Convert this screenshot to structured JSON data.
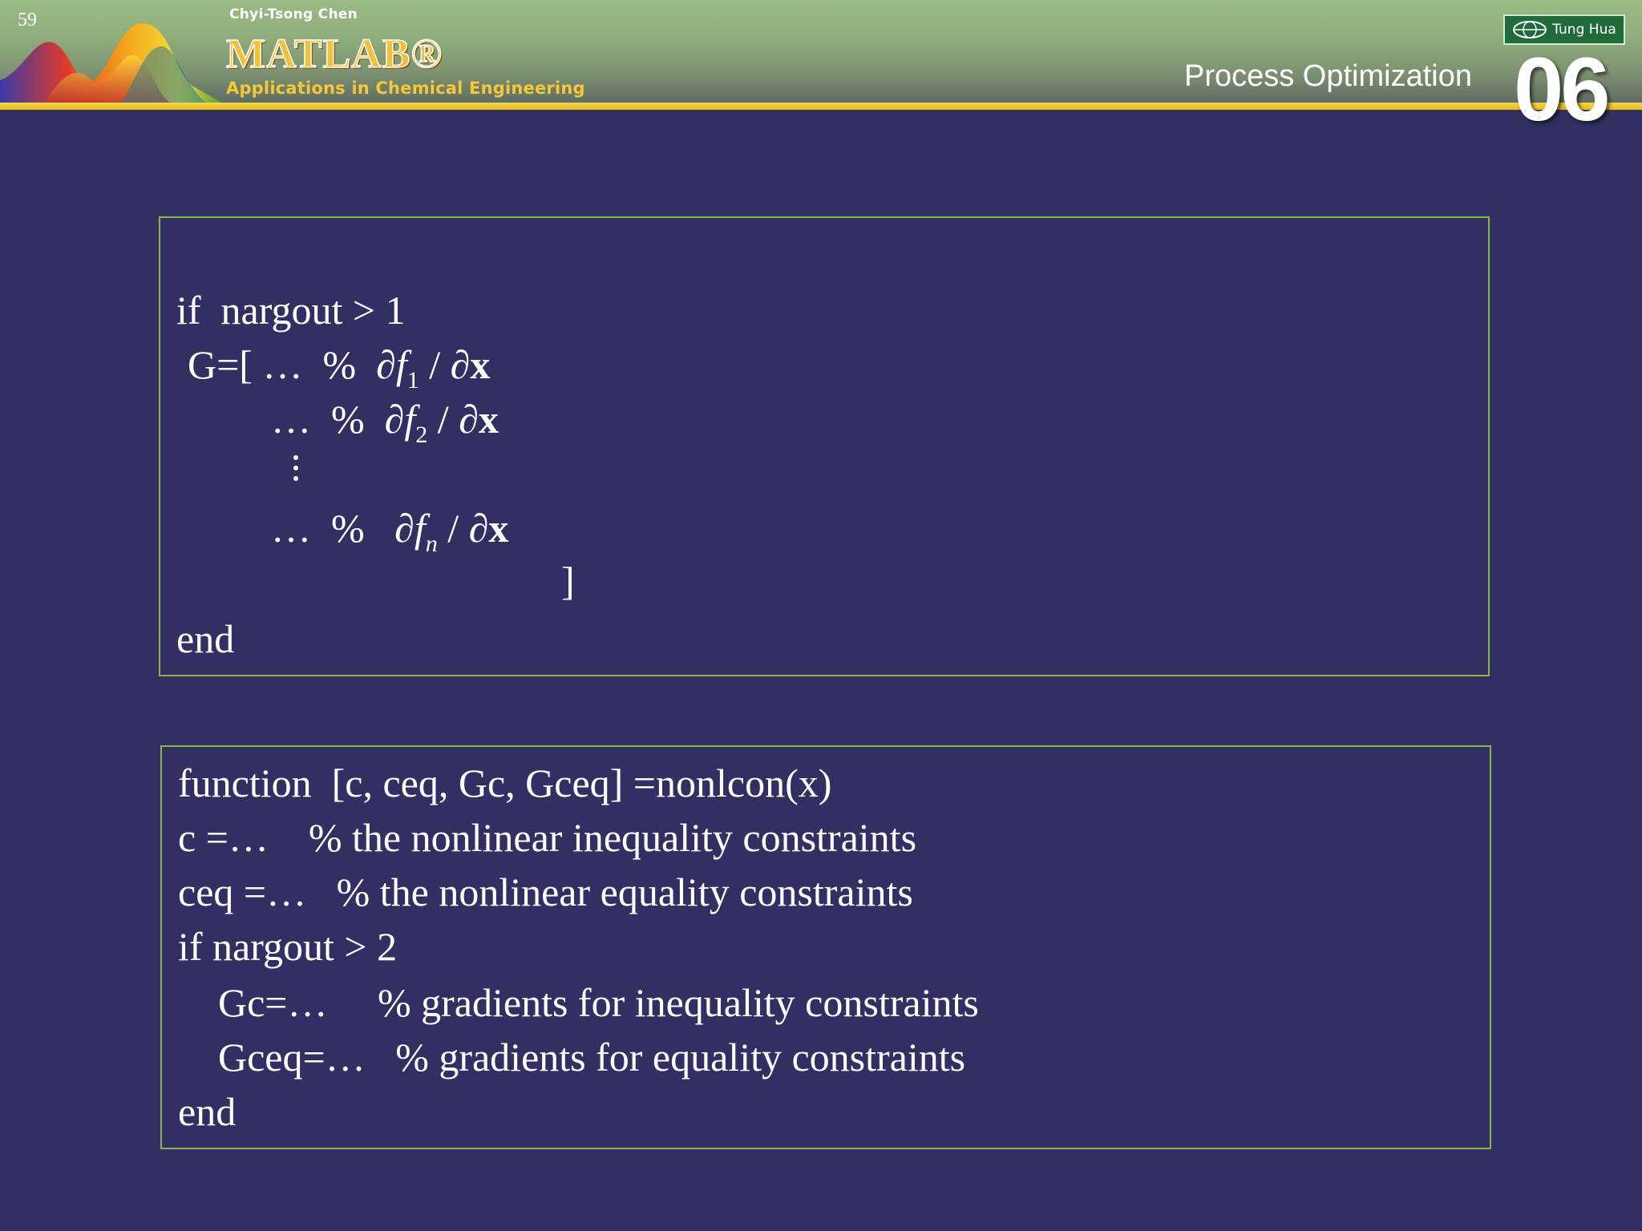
{
  "header": {
    "page_number": "59",
    "author": "Chyi-Tsong Chen",
    "book_title": "MATLAB®",
    "book_subtitle": "Applications in Chemical Engineering",
    "publisher": "Tung Hua",
    "chapter_title": "Process Optimization",
    "chapter_number": "06"
  },
  "code_block_1": {
    "line1": "if  nargout > 1",
    "g_open": "G=[",
    "dots": "…",
    "percent": "%",
    "partial": "∂",
    "f": "f",
    "sub1": "1",
    "sub2": "2",
    "subn": "n",
    "slash": "/",
    "x_var": "x",
    "close_bracket": "]",
    "end": "end"
  },
  "code_block_2": {
    "lines": [
      "function  [c, ceq, Gc, Gceq] =nonlcon(x)",
      "c =…    % the nonlinear inequality constraints",
      "ceq =…   % the nonlinear equality constraints",
      "if nargout > 2",
      "    Gc=…     % gradients for inequality constraints",
      "    Gceq=…   % gradients for equality constraints",
      "end"
    ]
  },
  "colors": {
    "background": "#323063",
    "box_border": "#8db34c",
    "gold_line": "#e8b81e",
    "logo_gold": "#f2c13a"
  }
}
